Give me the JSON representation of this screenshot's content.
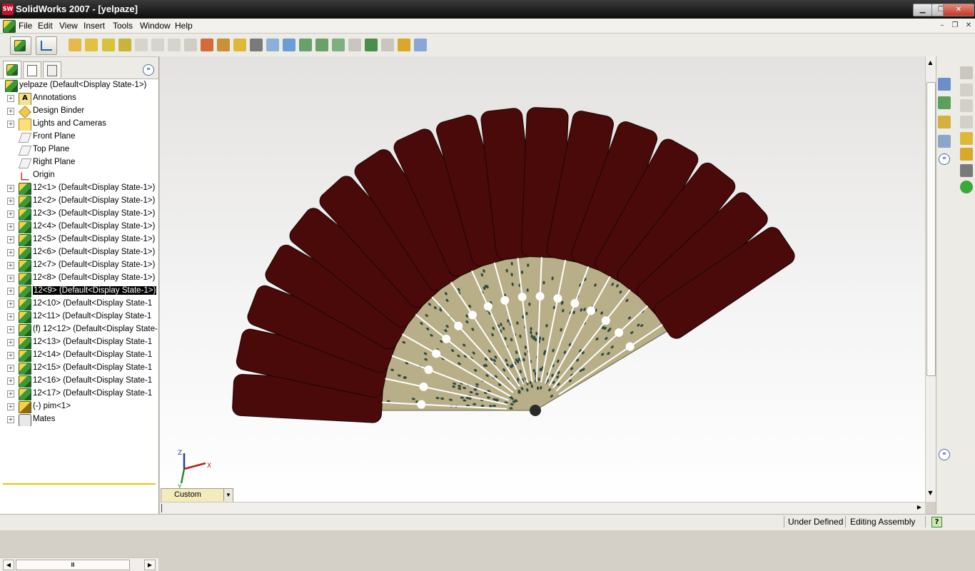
{
  "window": {
    "title": "SolidWorks 2007 - [yelpaze]",
    "app_icon": "SW"
  },
  "window_controls": {
    "minimize": "▁",
    "restore": "❐",
    "close": "✕"
  },
  "menu": [
    "File",
    "Edit",
    "View",
    "Insert",
    "Tools",
    "Window",
    "Help"
  ],
  "mdi_controls": {
    "minimize": "–",
    "restore": "❐",
    "close": "✕"
  },
  "feature_tree": {
    "root": "yelpaze  (Default<Display State-1>)",
    "items": [
      {
        "label": "Annotations",
        "icon": "annotations-icon",
        "expandable": true
      },
      {
        "label": "Design Binder",
        "icon": "design-binder-icon",
        "expandable": true
      },
      {
        "label": "Lights and Cameras",
        "icon": "lights-icon",
        "expandable": true
      },
      {
        "label": "Front Plane",
        "icon": "plane-icon",
        "expandable": false
      },
      {
        "label": "Top Plane",
        "icon": "plane-icon",
        "expandable": false
      },
      {
        "label": "Right Plane",
        "icon": "plane-icon",
        "expandable": false
      },
      {
        "label": "Origin",
        "icon": "origin-icon",
        "expandable": false
      },
      {
        "label": "12<1> (Default<Display State-1>)",
        "icon": "part-icon",
        "expandable": true
      },
      {
        "label": "12<2> (Default<Display State-1>)",
        "icon": "part-icon",
        "expandable": true
      },
      {
        "label": "12<3> (Default<Display State-1>)",
        "icon": "part-icon",
        "expandable": true
      },
      {
        "label": "12<4> (Default<Display State-1>)",
        "icon": "part-icon",
        "expandable": true
      },
      {
        "label": "12<5> (Default<Display State-1>)",
        "icon": "part-icon",
        "expandable": true
      },
      {
        "label": "12<6> (Default<Display State-1>)",
        "icon": "part-icon",
        "expandable": true
      },
      {
        "label": "12<7> (Default<Display State-1>)",
        "icon": "part-icon",
        "expandable": true
      },
      {
        "label": "12<8> (Default<Display State-1>)",
        "icon": "part-icon",
        "expandable": true
      },
      {
        "label": "12<9> (Default<Display State-1>)",
        "icon": "part-icon",
        "expandable": true,
        "selected": true
      },
      {
        "label": "12<10> (Default<Display State-1",
        "icon": "part-icon",
        "expandable": true
      },
      {
        "label": "12<11> (Default<Display State-1",
        "icon": "part-icon",
        "expandable": true
      },
      {
        "label": "(f) 12<12> (Default<Display State-",
        "icon": "part-icon",
        "expandable": true
      },
      {
        "label": "12<13> (Default<Display State-1",
        "icon": "part-icon",
        "expandable": true
      },
      {
        "label": "12<14> (Default<Display State-1",
        "icon": "part-icon",
        "expandable": true
      },
      {
        "label": "12<15> (Default<Display State-1",
        "icon": "part-icon",
        "expandable": true
      },
      {
        "label": "12<16> (Default<Display State-1",
        "icon": "part-icon",
        "expandable": true
      },
      {
        "label": "12<17> (Default<Display State-1",
        "icon": "part-icon",
        "expandable": true
      },
      {
        "label": "(-) pim<1>",
        "icon": "pim-icon",
        "expandable": true
      },
      {
        "label": "Mates",
        "icon": "mates-icon",
        "expandable": true
      }
    ]
  },
  "view": {
    "orientation": "Custom",
    "triad_labels": {
      "x": "X",
      "y": "Y",
      "z": "Z"
    }
  },
  "fan": {
    "blade_count": 17,
    "blade_color": "#4a0a0a",
    "hub_color": "#b8ae88",
    "pattern_color": "#2f4a40"
  },
  "status": {
    "state": "Under Defined",
    "mode": "Editing Assembly",
    "help": "?"
  }
}
